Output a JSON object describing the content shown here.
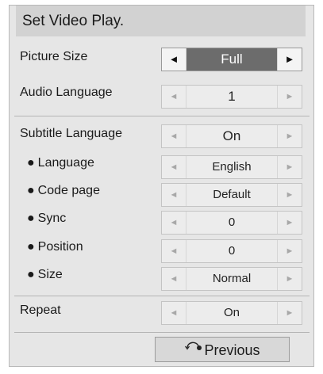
{
  "title": "Set Video Play.",
  "rows": {
    "picture_size": {
      "label": "Picture Size",
      "value": "Full"
    },
    "audio_language": {
      "label": "Audio Language",
      "value": "1"
    },
    "subtitle_language": {
      "label": "Subtitle Language",
      "value": "On"
    },
    "language": {
      "label": "Language",
      "value": "English"
    },
    "code_page": {
      "label": "Code page",
      "value": "Default"
    },
    "sync": {
      "label": "Sync",
      "value": "0"
    },
    "position": {
      "label": "Position",
      "value": "0"
    },
    "size": {
      "label": "Size",
      "value": "Normal"
    },
    "repeat": {
      "label": "Repeat",
      "value": "On"
    }
  },
  "bullet": "●",
  "arrows": {
    "left": "◄",
    "right": "►"
  },
  "previous_button": {
    "label": "Previous",
    "icon": "return-arrow-icon"
  },
  "colors": {
    "panel_bg": "#e6e6e6",
    "title_bg": "#d2d2d2",
    "active_value_bg": "#6c6c6c",
    "active_value_text": "#ffffff"
  }
}
